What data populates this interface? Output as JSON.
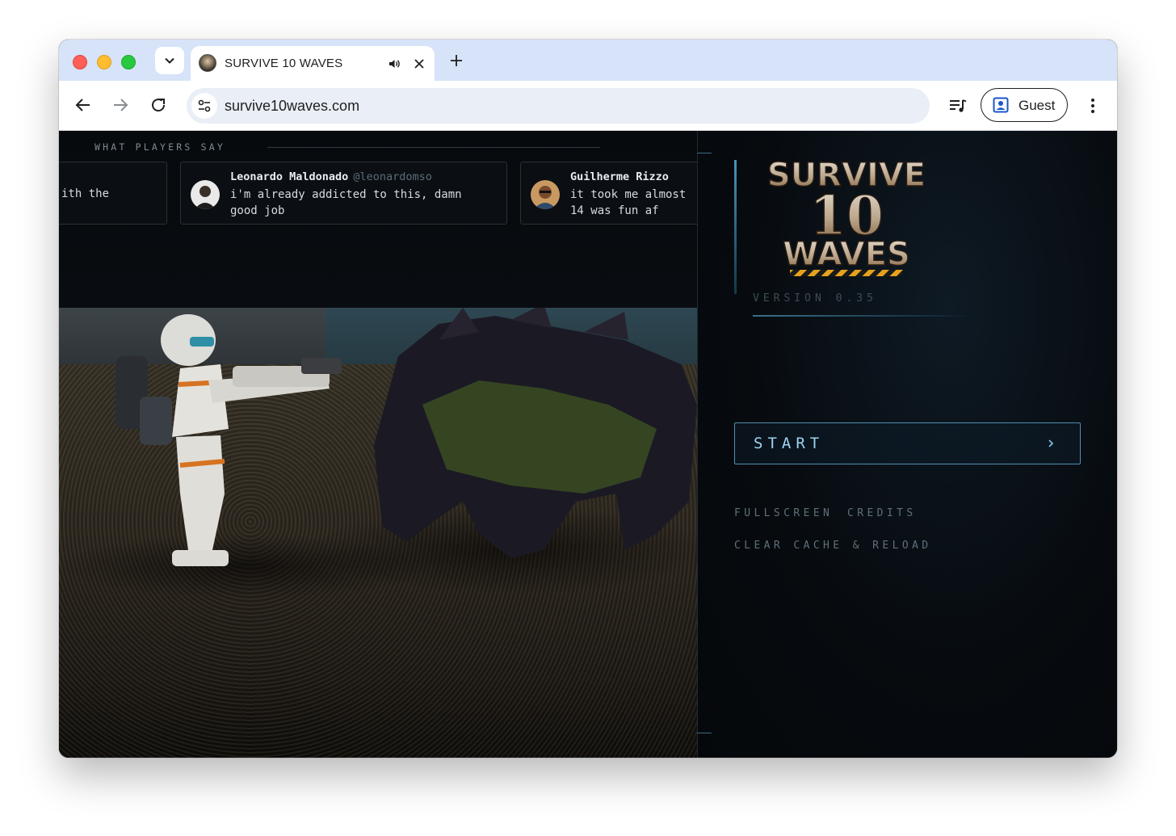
{
  "browser": {
    "tab": {
      "title": "SURVIVE 10 WAVES",
      "favicon": "game-logo-icon",
      "audio_icon": "speaker-icon",
      "close_icon": "close-icon"
    },
    "new_tab_icon": "plus-icon",
    "tab_search_icon": "chevron-down-icon",
    "address": "survive10waves.com",
    "profile_label": "Guest"
  },
  "page": {
    "reviews": {
      "heading": "WHAT PLAYERS SAY",
      "items": [
        {
          "name": "",
          "handle": "",
          "text": "ith the"
        },
        {
          "name": "Leonardo Maldonado",
          "handle": "@leonardomso",
          "text": "i'm already addicted to this, damn good job"
        },
        {
          "name": "Guilherme Rizzo",
          "handle": "",
          "text": "it took me almost 14 was fun af"
        }
      ]
    },
    "menu": {
      "version": "VERSION 0.35",
      "start": "START",
      "fullscreen": "FULLSCREEN",
      "credits": "CREDITS",
      "clear_cache": "CLEAR CACHE & RELOAD"
    },
    "colors": {
      "accent": "#4f8fb1",
      "start_text": "#9bd3f0",
      "background": "#040709"
    }
  }
}
